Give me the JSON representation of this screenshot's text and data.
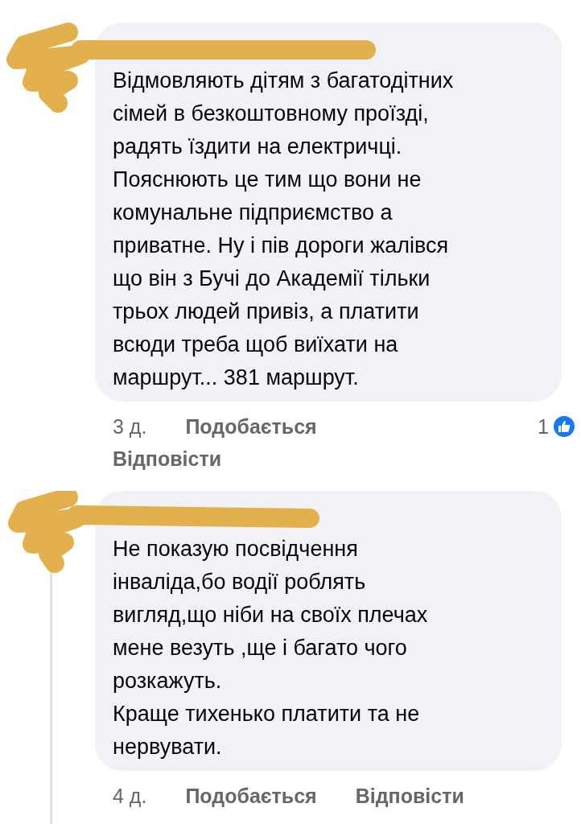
{
  "comments": [
    {
      "body": "Відмовляють дітям з багатодітних\nсімей в безкоштовному проїзді,\nрадять їздити на електричці.\nПояснюють це тим що вони не\nкомунальне підприємство а\nприватне. Ну і пів дороги жалівся\nщо він з Бучі до Академії тільки\nтрьох людей привіз, а платити\nвсюди треба щоб виїхати на\nмаршрут... 381 маршрут.",
      "time": "3 д.",
      "like_label": "Подобається",
      "reply_label": "Відповісти",
      "reaction_count": "1"
    },
    {
      "body": "Не показую посвідчення\nінваліда,бо водії роблять\nвигляд,що ніби на своїх плечах\nмене везуть ,ще і багато чого\nрозкажуть.\nКраще тихенько платити та не\nнервувати.",
      "time": "4 д.",
      "like_label": "Подобається",
      "reply_label": "Відповісти",
      "thread_line": true
    }
  ]
}
